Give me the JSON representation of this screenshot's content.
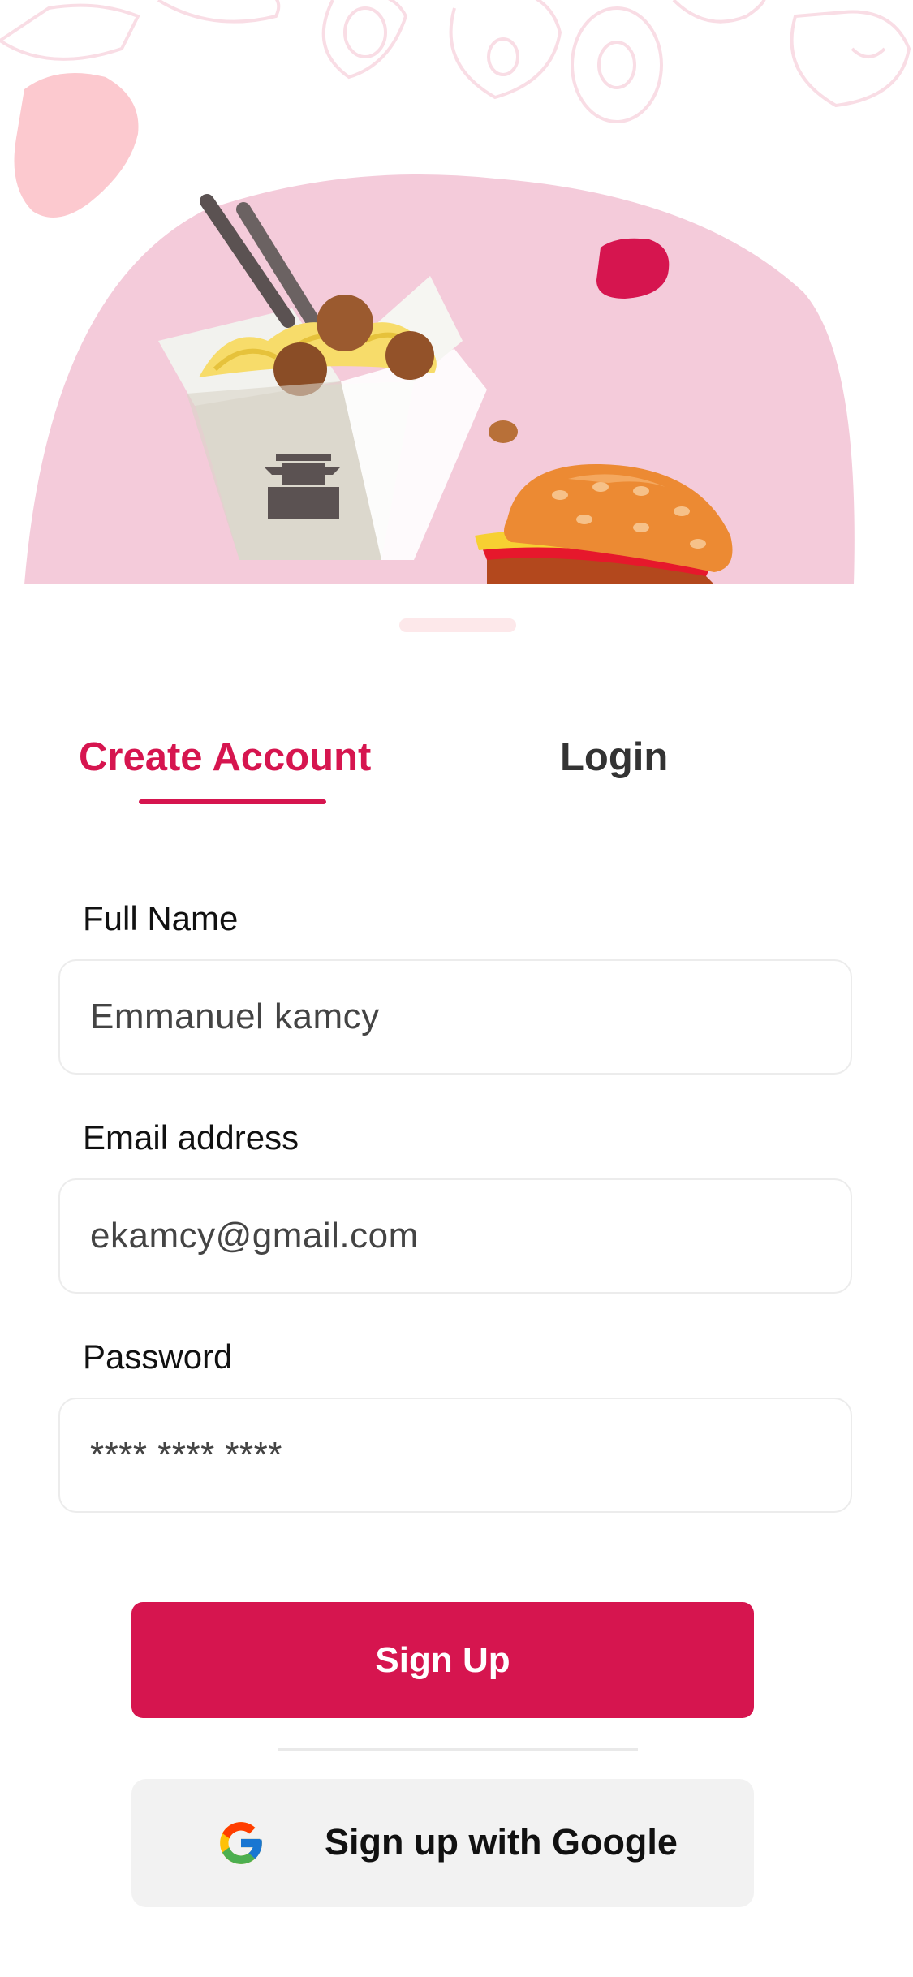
{
  "tabs": {
    "create_account": "Create Account",
    "login": "Login"
  },
  "form": {
    "full_name_label": "Full Name",
    "full_name_value": "Emmanuel kamcy",
    "email_label": "Email address",
    "email_value": "ekamcy@gmail.com",
    "password_label": "Password",
    "password_value": "**** **** ****"
  },
  "buttons": {
    "sign_up": "Sign Up",
    "google": "Sign up with Google"
  },
  "colors": {
    "accent": "#d6154f",
    "hero_pink": "#f4cbda",
    "google_button_bg": "#f2f2f2"
  },
  "icons": [
    "google-icon"
  ]
}
